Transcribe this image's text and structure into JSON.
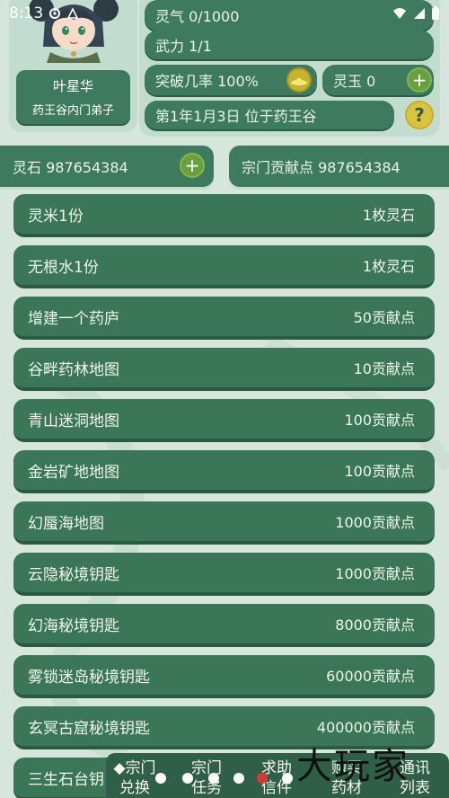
{
  "status_bar": {
    "time": "8:13",
    "icons": [
      "gear-icon",
      "notification-icon",
      "signal-icon",
      "wifi-icon",
      "cell-signal-icon",
      "battery-icon"
    ]
  },
  "profile": {
    "name": "叶星华",
    "title": "药王谷内门弟子"
  },
  "stats": {
    "lingqi": "灵气 0/1000",
    "wuli": "武力 1/1",
    "tupo": "突破几率 100%",
    "lingyu": "灵玉 0",
    "date_location": "第1年1月3日 位于药王谷",
    "help_label": "?",
    "plus_label": "+"
  },
  "resources": {
    "lingshi": "灵石 987654384",
    "contribution": "宗门贡献点 987654384",
    "plus_label": "+"
  },
  "shop": {
    "items": [
      {
        "name": "灵米1份",
        "price": "1枚灵石"
      },
      {
        "name": "无根水1份",
        "price": "1枚灵石"
      },
      {
        "name": "增建一个药庐",
        "price": "50贡献点"
      },
      {
        "name": "谷畔药林地图",
        "price": "10贡献点"
      },
      {
        "name": "青山迷洞地图",
        "price": "100贡献点"
      },
      {
        "name": "金岩矿地地图",
        "price": "100贡献点"
      },
      {
        "name": "幻蜃海地图",
        "price": "1000贡献点"
      },
      {
        "name": "云隐秘境钥匙",
        "price": "1000贡献点"
      },
      {
        "name": "幻海秘境钥匙",
        "price": "8000贡献点"
      },
      {
        "name": "雾锁迷岛秘境钥匙",
        "price": "60000贡献点"
      },
      {
        "name": "玄冥古窟秘境钥匙",
        "price": "400000贡献点"
      },
      {
        "name": "三生石台钥",
        "price": ""
      }
    ]
  },
  "bottom_nav": {
    "items": [
      {
        "line1": "◆宗门",
        "line2": "兑换"
      },
      {
        "line1": "宗门",
        "line2": "任务"
      },
      {
        "line1": "求助",
        "line2": "信件"
      },
      {
        "line1": "购买",
        "line2": "药材"
      },
      {
        "line1": "通讯",
        "line2": "列表"
      }
    ]
  },
  "watermark": "大玩家",
  "colors": {
    "page_bg": "#d6e6dd",
    "panel_bg": "#c2ddd0",
    "item_green": "#3b7658",
    "nav_green": "#2f5f48",
    "plus_btn": "#6a9f3f",
    "help_btn": "#d9c341"
  }
}
